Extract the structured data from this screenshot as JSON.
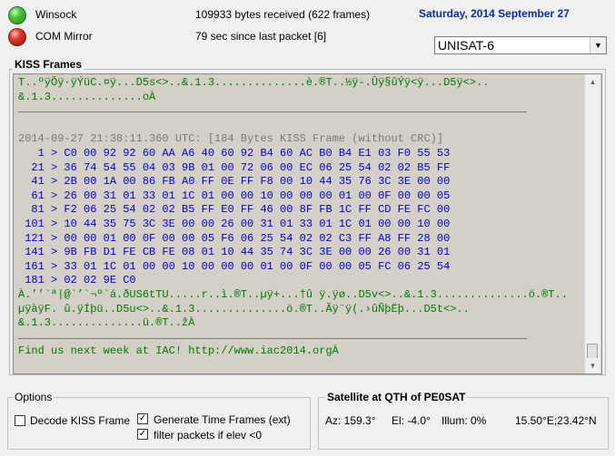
{
  "status": {
    "winsock_label": "Winsock",
    "com_label": "COM Mirror",
    "bytes_text": "109933 bytes received (622 frames)",
    "since_text": "79 sec since last packet [6]",
    "date": "Saturday, 2014 September 27",
    "winsock_color": "#2fa82a",
    "com_color": "#d02a1e"
  },
  "satellite_select": {
    "value": "UNISAT-6"
  },
  "kiss": {
    "title": "KISS Frames",
    "lines": [
      {
        "style": "green",
        "text": "T..ºÿÕÿ·ÿÝüC.¤ÿ...D5s<>..&.1.3..............è.®T..½ÿ-.Ûÿ§ûÝÿ<ÿ...D5ÿ<>.."
      },
      {
        "style": "green",
        "text": "&.1.3..............oÀ"
      },
      {
        "style": "sep",
        "text": ""
      },
      {
        "style": "gray",
        "text": ""
      },
      {
        "style": "gray",
        "text": "2014-09-27 21:38:11.360 UTC: [184 Bytes KISS Frame (without CRC)]"
      },
      {
        "style": "blue",
        "text": "   1 > C0 00 92 92 60 AA A6 40 60 92 B4 60 AC B0 B4 E1 03 F0 55 53"
      },
      {
        "style": "blue",
        "text": "  21 > 36 74 54 55 04 03 9B 01 00 72 06 00 EC 06 25 54 02 02 B5 FF"
      },
      {
        "style": "blue",
        "text": "  41 > 2B 00 1A 00 86 FB A0 FF 0E FF F8 00 10 44 35 76 3C 3E 00 00"
      },
      {
        "style": "blue",
        "text": "  61 > 26 00 31 01 33 01 1C 01 00 00 10 00 00 00 01 00 0F 00 00 05"
      },
      {
        "style": "blue",
        "text": "  81 > F2 06 25 54 02 02 B5 FF E0 FF 46 00 8F FB 1C FF CD FE FC 00"
      },
      {
        "style": "blue",
        "text": " 101 > 10 44 35 75 3C 3E 00 00 26 00 31 01 33 01 1C 01 00 00 10 00"
      },
      {
        "style": "blue",
        "text": " 121 > 00 00 01 00 0F 00 00 05 F6 06 25 54 02 02 C3 FF A8 FF 28 00"
      },
      {
        "style": "blue",
        "text": " 141 > 9B FB D1 FE CB FE 08 01 10 44 35 74 3C 3E 00 00 26 00 31 01"
      },
      {
        "style": "blue",
        "text": " 161 > 33 01 1C 01 00 00 10 00 00 00 01 00 0F 00 00 05 FC 06 25 54"
      },
      {
        "style": "blue",
        "text": " 181 > 02 02 9E C0"
      },
      {
        "style": "green",
        "text": "À.’’`ª|@`’`¬º`á.ðUS6tTU.....r..ì.®T..µÿ+...†û ÿ.ÿø..D5v<>..&.1.3..............ö.®T.."
      },
      {
        "style": "green",
        "text": "µÿàÿF. û.ÿÍþü..D5u<>..&.1.3..............ö.®T..Ãÿ¨ÿ(.›ûÑþËþ...D5t<>.."
      },
      {
        "style": "green",
        "text": "&.1.3..............ü.®T..žÀ"
      },
      {
        "style": "sep",
        "text": ""
      },
      {
        "style": "green",
        "text": "Find us next week at IAC! http://www.iac2014.orgÀ"
      }
    ]
  },
  "options": {
    "title": "Options",
    "decode_label": "Decode KISS Frame",
    "decode_checked": false,
    "gen_time_label": "Generate Time Frames (ext)",
    "gen_time_checked": true,
    "filter_label": "filter packets if elev <0",
    "filter_checked": true
  },
  "satellite_info": {
    "title": "Satellite at QTH of PE0SAT",
    "az": "Az: 159.3°",
    "el": "El: -4.0°",
    "illum": "Illum: 0%",
    "pos": "15.50°E;23.42°N"
  }
}
